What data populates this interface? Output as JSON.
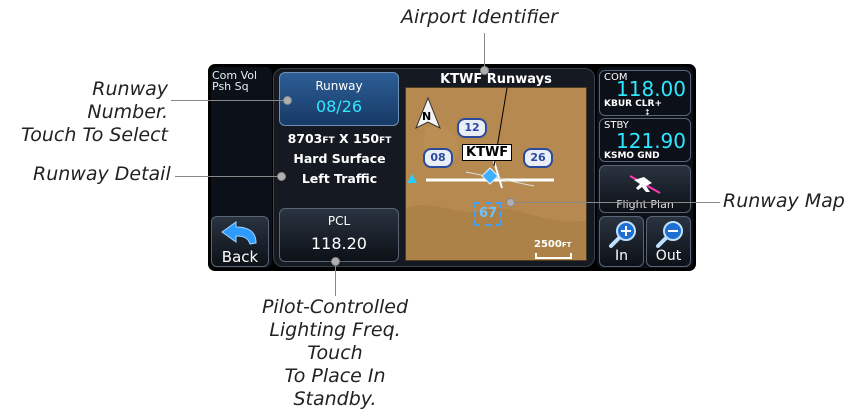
{
  "callouts": {
    "airport_identifier": "Airport Identifier",
    "runway_number_line1": "Runway Number.",
    "runway_number_line2": "Touch To Select",
    "runway_detail": "Runway Detail",
    "runway_map": "Runway Map",
    "pcl_line1": "Pilot-Controlled",
    "pcl_line2": "Lighting Freq. Touch",
    "pcl_line3": "To Place In Standby."
  },
  "left_panel": {
    "com_vol_line1": "Com Vol",
    "com_vol_line2": "Psh Sq",
    "back_label": "Back"
  },
  "runway_button": {
    "label": "Runway",
    "value": "08/26"
  },
  "runway_info": {
    "length": "8703",
    "length_unit": "FT",
    "width_sep": "X",
    "width": "150",
    "width_unit": "FT",
    "surface": "Hard Surface",
    "traffic": "Left Traffic"
  },
  "pcl_button": {
    "label": "PCL",
    "value": "118.20"
  },
  "map": {
    "title": "KTWF Runways",
    "airport_id": "KTWF",
    "north": "N",
    "runway_12": "12",
    "runway_08": "08",
    "runway_26": "26",
    "marker_67": "67",
    "scale_value": "2500",
    "scale_unit": "FT"
  },
  "right_panel": {
    "com_label": "COM",
    "com_freq": "118.00",
    "com_station": "KBUR CLR+",
    "stby_label": "STBY",
    "stby_freq": "121.90",
    "stby_station": "KSMO GND",
    "flight_plan_label": "Flight Plan",
    "zoom_in_label": "In",
    "zoom_out_label": "Out"
  },
  "colors": {
    "accent_cyan": "#2ee8ff",
    "map_terrain": "#b5894f",
    "button_blue": "#2d5e96"
  }
}
